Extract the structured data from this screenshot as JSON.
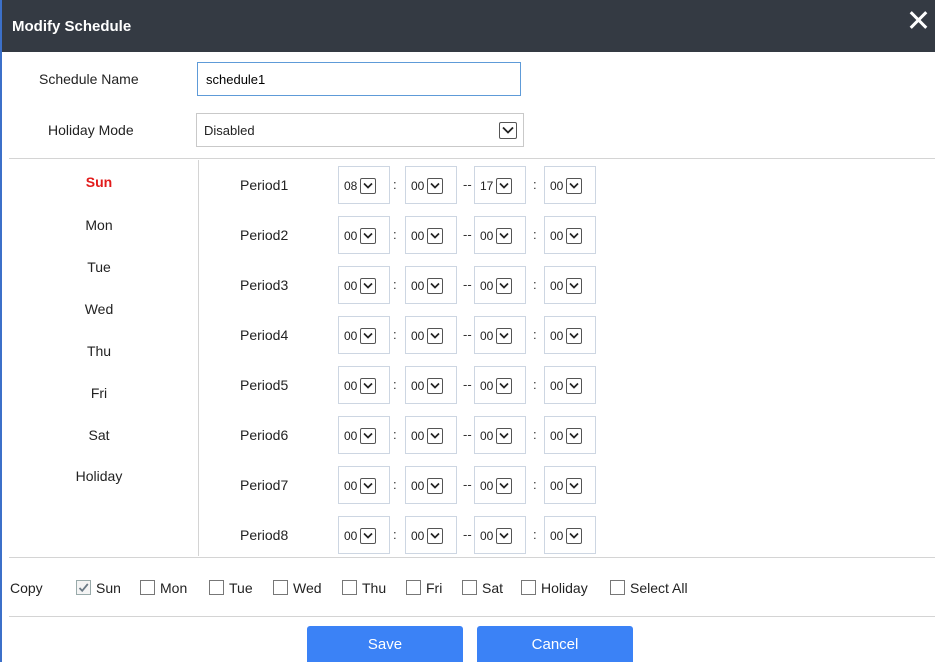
{
  "dialog": {
    "title": "Modify Schedule"
  },
  "form": {
    "name_label": "Schedule Name",
    "name_value": "schedule1",
    "holiday_label": "Holiday Mode",
    "holiday_value": "Disabled"
  },
  "days": [
    "Sun",
    "Mon",
    "Tue",
    "Wed",
    "Thu",
    "Fri",
    "Sat",
    "Holiday"
  ],
  "selected_day": "Sun",
  "periods": [
    {
      "label": "Period1",
      "start_h": "08",
      "start_m": "00",
      "end_h": "17",
      "end_m": "00"
    },
    {
      "label": "Period2",
      "start_h": "00",
      "start_m": "00",
      "end_h": "00",
      "end_m": "00"
    },
    {
      "label": "Period3",
      "start_h": "00",
      "start_m": "00",
      "end_h": "00",
      "end_m": "00"
    },
    {
      "label": "Period4",
      "start_h": "00",
      "start_m": "00",
      "end_h": "00",
      "end_m": "00"
    },
    {
      "label": "Period5",
      "start_h": "00",
      "start_m": "00",
      "end_h": "00",
      "end_m": "00"
    },
    {
      "label": "Period6",
      "start_h": "00",
      "start_m": "00",
      "end_h": "00",
      "end_m": "00"
    },
    {
      "label": "Period7",
      "start_h": "00",
      "start_m": "00",
      "end_h": "00",
      "end_m": "00"
    },
    {
      "label": "Period8",
      "start_h": "00",
      "start_m": "00",
      "end_h": "00",
      "end_m": "00"
    }
  ],
  "separators": {
    "colon": ":",
    "dash": "--"
  },
  "copy": {
    "label": "Copy",
    "options": [
      {
        "label": "Sun",
        "checked": true
      },
      {
        "label": "Mon",
        "checked": false
      },
      {
        "label": "Tue",
        "checked": false
      },
      {
        "label": "Wed",
        "checked": false
      },
      {
        "label": "Thu",
        "checked": false
      },
      {
        "label": "Fri",
        "checked": false
      },
      {
        "label": "Sat",
        "checked": false
      },
      {
        "label": "Holiday",
        "checked": false
      },
      {
        "label": "Select All",
        "checked": false
      }
    ]
  },
  "buttons": {
    "save": "Save",
    "cancel": "Cancel"
  },
  "colors": {
    "titlebar": "#343a43",
    "accent": "#3b82f6",
    "active_day": "#e21b1b"
  }
}
